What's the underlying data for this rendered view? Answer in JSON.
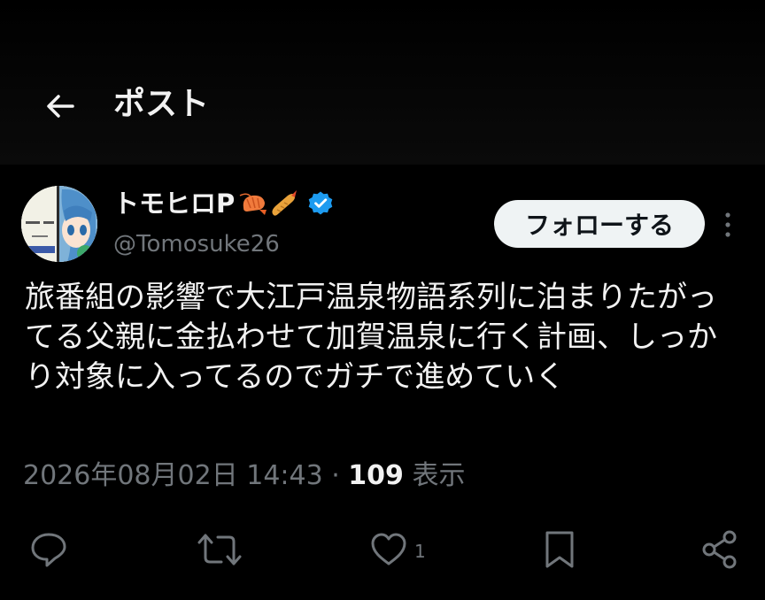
{
  "header": {
    "back_icon": "arrow-left-icon",
    "title": "ポスト"
  },
  "author": {
    "name": "トモヒロP",
    "name_emoji": [
      "shrimp-icon",
      "fried-shrimp-icon"
    ],
    "verified_icon": "verified-badge-icon",
    "verified_color": "#1d9bf0",
    "handle": "@Tomosuke26"
  },
  "follow_button": {
    "label": "フォローする"
  },
  "more_icon": "more-vertical-icon",
  "post": {
    "text": "旅番組の影響で大江戸温泉物語系列に泊まりたがってる父親に金払わせて加賀温泉に行く計画、しっかり対象に入ってるのでガチで進めていく",
    "timestamp": "2026年08月02日 14:43",
    "separator": " · ",
    "views_count": "109",
    "views_label": " 表示"
  },
  "actions": {
    "reply_icon": "reply-icon",
    "repost_icon": "repost-icon",
    "like_icon": "heart-icon",
    "like_count": "1",
    "bookmark_icon": "bookmark-icon",
    "share_icon": "share-icon"
  },
  "colors": {
    "background": "#000000",
    "text_primary": "#f2f2f2",
    "text_secondary": "#71767b",
    "follow_bg": "#eff3f4"
  }
}
